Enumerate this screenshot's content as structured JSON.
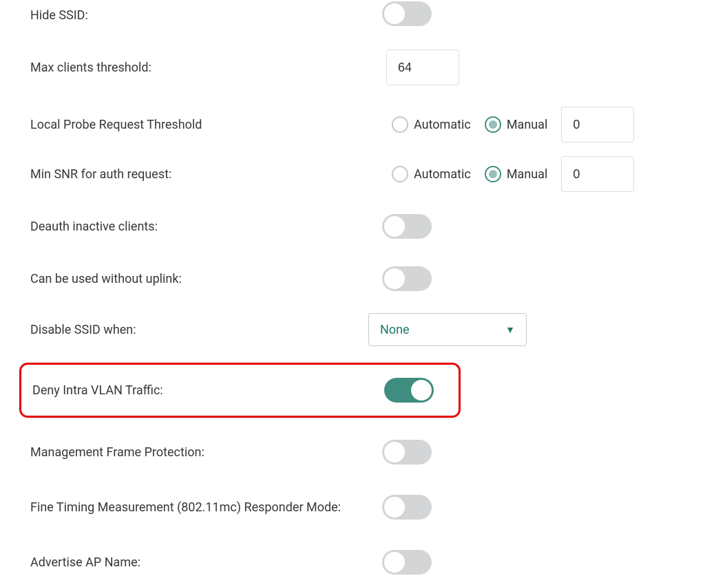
{
  "colors": {
    "accent": "#3f8d7f",
    "highlight_border": "#e60000",
    "toggle_off": "#d3d5d6"
  },
  "fields": {
    "hide_ssid": {
      "label": "Hide SSID:",
      "enabled": false
    },
    "max_clients": {
      "label": "Max clients threshold:",
      "value": "64"
    },
    "probe_threshold": {
      "label": "Local Probe Request Threshold",
      "options": {
        "automatic": "Automatic",
        "manual": "Manual"
      },
      "selected": "manual",
      "value": "0"
    },
    "min_snr": {
      "label": "Min SNR for auth request:",
      "options": {
        "automatic": "Automatic",
        "manual": "Manual"
      },
      "selected": "manual",
      "value": "0"
    },
    "deauth_inactive": {
      "label": "Deauth inactive clients:",
      "enabled": false
    },
    "without_uplink": {
      "label": "Can be used without uplink:",
      "enabled": false
    },
    "disable_ssid_when": {
      "label": "Disable SSID when:",
      "value": "None"
    },
    "deny_intra_vlan": {
      "label": "Deny Intra VLAN Traffic:",
      "enabled": true
    },
    "mfp": {
      "label": "Management Frame Protection:",
      "enabled": false
    },
    "ftm": {
      "label": "Fine Timing Measurement (802.11mc) Responder Mode:",
      "enabled": false
    },
    "advertise_ap": {
      "label": "Advertise AP Name:",
      "enabled": false
    }
  }
}
